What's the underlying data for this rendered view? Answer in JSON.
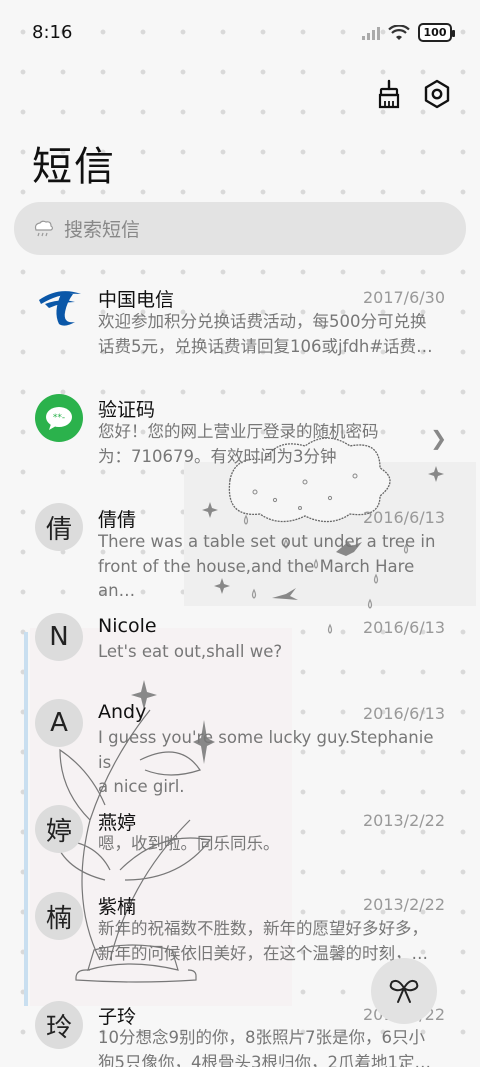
{
  "status_bar": {
    "time": "8:16",
    "battery": "100"
  },
  "toolbar": {
    "clean_icon": "broom-icon",
    "settings_icon": "hexagon-settings-icon"
  },
  "header": {
    "title": "短信"
  },
  "search": {
    "placeholder": "搜索短信"
  },
  "messages": [
    {
      "avatar": "",
      "sender": "中国电信",
      "date": "2017/6/30",
      "preview": "欢迎参加积分兑换话费活动，每500分可兑换\n话费5元，兑换话费请回复106或jfdh#话费…"
    },
    {
      "avatar": "",
      "sender": "验证码",
      "date": "",
      "preview": "您好！您的网上营业厅登录的随机密码\n为：710679。有效时间为3分钟"
    },
    {
      "avatar": "倩",
      "sender": "倩倩",
      "date": "2016/6/13",
      "preview": "There was a table set out under a tree in\nfront of the house,and the March Hare an…"
    },
    {
      "avatar": "N",
      "sender": "Nicole",
      "date": "2016/6/13",
      "preview": "Let's eat out,shall we?"
    },
    {
      "avatar": "A",
      "sender": "Andy",
      "date": "2016/6/13",
      "preview": "I guess you're some lucky guy.Stephanie is\na nice girl."
    },
    {
      "avatar": "婷",
      "sender": "燕婷",
      "date": "2013/2/22",
      "preview": "嗯，收到啦。同乐同乐。"
    },
    {
      "avatar": "楠",
      "sender": "紫楠",
      "date": "2013/2/22",
      "preview": "新年的祝福数不胜数，新年的愿望好多好多，\n新年的问候依旧美好，在这个温馨的时刻，…"
    },
    {
      "avatar": "玲",
      "sender": "子玲",
      "date": "2013/2/22",
      "preview": "10分想念9别的你，8张照片7张是你，6只小\n狗5只像你，4根骨头3根归你，2爪着地1定…"
    }
  ],
  "fab": {
    "icon": "bow-icon"
  },
  "colors": {
    "telecom_blue": "#0a57a8",
    "verify_green": "#2bb24c"
  }
}
